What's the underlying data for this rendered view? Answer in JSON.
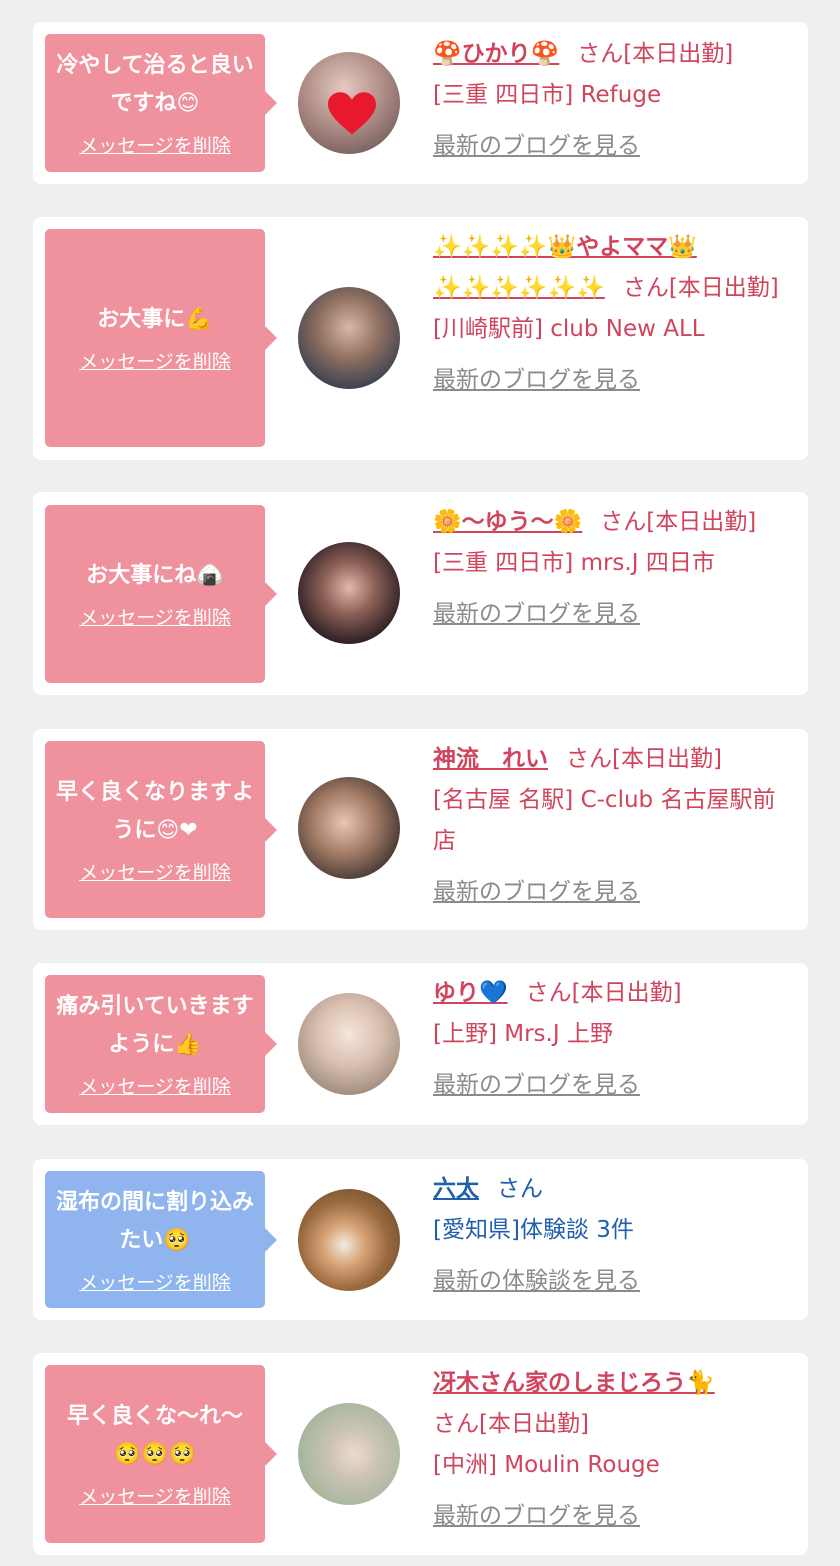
{
  "cards": [
    {
      "message": "冷やして治ると良いですね😊",
      "delete_label": "メッセージを削除",
      "name": "🍄ひかり🍄",
      "suffix": "さん[本日出勤]",
      "shop": "[三重 四日市] Refuge",
      "link": "最新のブログを見る",
      "bubble_color": "#ef929e",
      "text_color": "#d0455d"
    },
    {
      "message": "お大事に💪",
      "delete_label": "メッセージを削除",
      "name": "✨✨✨✨👑やよママ👑✨✨✨✨✨✨",
      "suffix": "さん[本日出勤]",
      "shop": "[川崎駅前] club New ALL",
      "link": "最新のブログを見る",
      "bubble_color": "#ef929e",
      "text_color": "#d0455d"
    },
    {
      "message": "お大事にね🍙",
      "delete_label": "メッセージを削除",
      "name": "🌼〜ゆう〜🌼",
      "suffix": "さん[本日出勤]",
      "shop": "[三重 四日市] mrs.J 四日市",
      "link": "最新のブログを見る",
      "bubble_color": "#ef929e",
      "text_color": "#d0455d"
    },
    {
      "message": "早く良くなりますように😊❤",
      "delete_label": "メッセージを削除",
      "name": "神流　れい",
      "suffix": "さん[本日出勤]",
      "shop": "[名古屋 名駅] C-club 名古屋駅前店",
      "link": "最新のブログを見る",
      "bubble_color": "#ef929e",
      "text_color": "#d0455d"
    },
    {
      "message": "痛み引いていきますように👍",
      "delete_label": "メッセージを削除",
      "name": "ゆり💙",
      "suffix": "さん[本日出勤]",
      "shop": "[上野] Mrs.J 上野",
      "link": "最新のブログを見る",
      "bubble_color": "#ef929e",
      "text_color": "#d0455d"
    },
    {
      "message": "湿布の間に割り込みたい🥺",
      "delete_label": "メッセージを削除",
      "name": "六太",
      "suffix": "さん",
      "shop": "[愛知県]体験談 3件",
      "link": "最新の体験談を見る",
      "bubble_color": "#8fb4ee",
      "text_color": "#1f5fae"
    },
    {
      "message": "早く良くな〜れ〜🥺🥺🥺",
      "delete_label": "メッセージを削除",
      "name": "冴木さん家のしまじろう🐈",
      "suffix": "さん[本日出勤]",
      "shop": "[中洲] Moulin Rouge",
      "link": "最新のブログを見る",
      "bubble_color": "#ef929e",
      "text_color": "#d0455d"
    }
  ]
}
